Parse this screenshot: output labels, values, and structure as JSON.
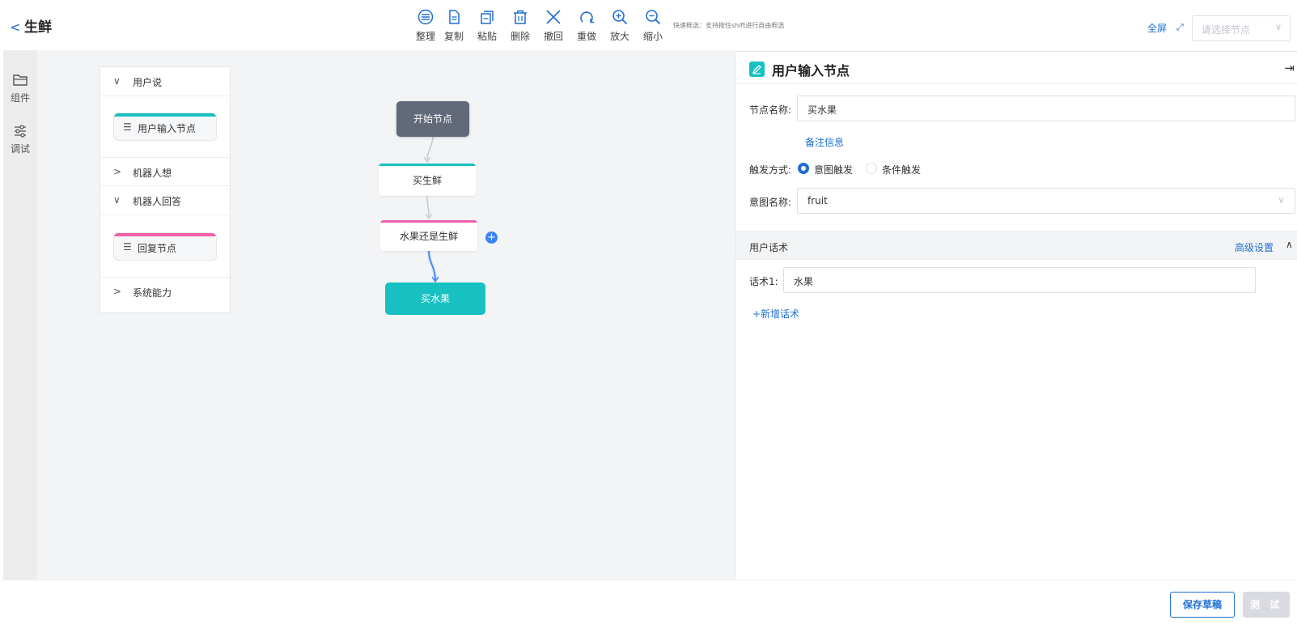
{
  "header": {
    "back_icon": "<",
    "title": "生鲜",
    "toolbar": [
      {
        "icon": "arrange-icon",
        "label": "整理"
      },
      {
        "icon": "copy-icon",
        "label": "复制"
      },
      {
        "icon": "paste-icon",
        "label": "粘贴"
      },
      {
        "icon": "delete-icon",
        "label": "删除"
      },
      {
        "icon": "undo-icon",
        "label": "撤回"
      },
      {
        "icon": "redo-icon",
        "label": "重做"
      },
      {
        "icon": "zoom-in-icon",
        "label": "放大"
      },
      {
        "icon": "zoom-out-icon",
        "label": "缩小"
      }
    ],
    "toolbar_hint": "快速框选：支持按住shift进行自由框选",
    "fullscreen": "全屏",
    "node_select_placeholder": "请选择节点"
  },
  "rail": {
    "components": "组件",
    "debug": "调试"
  },
  "component_panel": {
    "sections": [
      {
        "label": "用户说",
        "expanded": true,
        "cards": [
          {
            "label": "用户输入节点",
            "color": "#17c1c2"
          }
        ]
      },
      {
        "label": "机器人想",
        "expanded": false
      },
      {
        "label": "机器人回答",
        "expanded": true,
        "cards": [
          {
            "label": "回复节点",
            "color": "#f060a8"
          }
        ]
      },
      {
        "label": "系统能力",
        "expanded": false
      }
    ]
  },
  "flow": {
    "nodes": {
      "start": "开始节点",
      "buy_fresh": "买生鲜",
      "fruit_or_fresh": "水果还是生鲜",
      "buy_fruit": "买水果"
    },
    "add": "+"
  },
  "detail_panel": {
    "title": "用户输入节点",
    "node_name_label": "节点名称:",
    "node_name_value": "买水果",
    "remark_link": "备注信息",
    "trigger_label": "触发方式:",
    "trigger_options": [
      {
        "label": "意图触发",
        "selected": true
      },
      {
        "label": "条件触发",
        "selected": false
      }
    ],
    "intent_label": "意图名称:",
    "intent_value": "fruit",
    "user_speech_section": "用户话术",
    "advanced_settings": "高级设置",
    "speech_label": "话术1:",
    "speech_value": "水果",
    "add_speech": "+新增话术"
  },
  "footer": {
    "save_draft": "保存草稿",
    "test": "测 试"
  },
  "colors": {
    "accent": "#1f6fd1",
    "teal": "#17c1c2",
    "pink": "#f060a8",
    "start_node": "#626a7a"
  }
}
